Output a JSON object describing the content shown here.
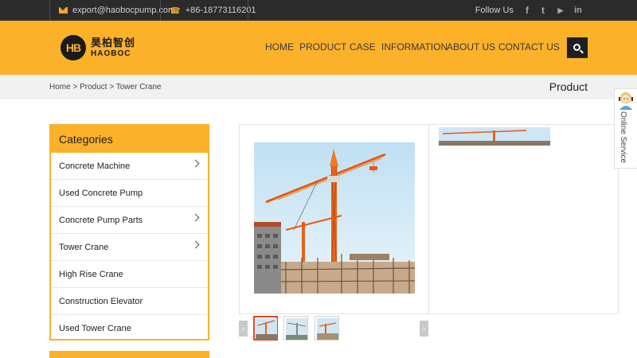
{
  "topbar": {
    "email": "export@haobocpump.com",
    "phone": "+86-18773116201",
    "follow_label": "Follow Us",
    "social": [
      {
        "icon": "facebook-icon",
        "glyph": "f"
      },
      {
        "icon": "twitter-icon",
        "glyph": "t"
      },
      {
        "icon": "youtube-icon",
        "glyph": "▶"
      },
      {
        "icon": "linkedin-icon",
        "glyph": "in"
      }
    ]
  },
  "logo": {
    "mark": "HB",
    "cn": "昊柏智创",
    "en": "HAOBOC"
  },
  "nav": [
    "HOME",
    "PRODUCT",
    "CASE",
    "INFORMATION",
    "ABOUT US",
    "CONTACT US"
  ],
  "breadcrumb": "Home > Product > Tower Crane",
  "page_title": "Product",
  "categories": {
    "title": "Categories",
    "items": [
      {
        "label": "Concrete Machine",
        "has_children": true
      },
      {
        "label": "Used Concrete Pump",
        "has_children": false
      },
      {
        "label": "Concrete Pump Parts",
        "has_children": true
      },
      {
        "label": "Tower Crane",
        "has_children": true
      },
      {
        "label": "High Rise Crane",
        "has_children": false
      },
      {
        "label": "Construction Elevator",
        "has_children": false
      },
      {
        "label": "Used Tower Crane",
        "has_children": false
      }
    ]
  },
  "service": {
    "label": "Online Service"
  },
  "colors": {
    "brand": "#fbb12a",
    "topbar": "#2b2b2b",
    "thumb_active": "#e1452a"
  }
}
